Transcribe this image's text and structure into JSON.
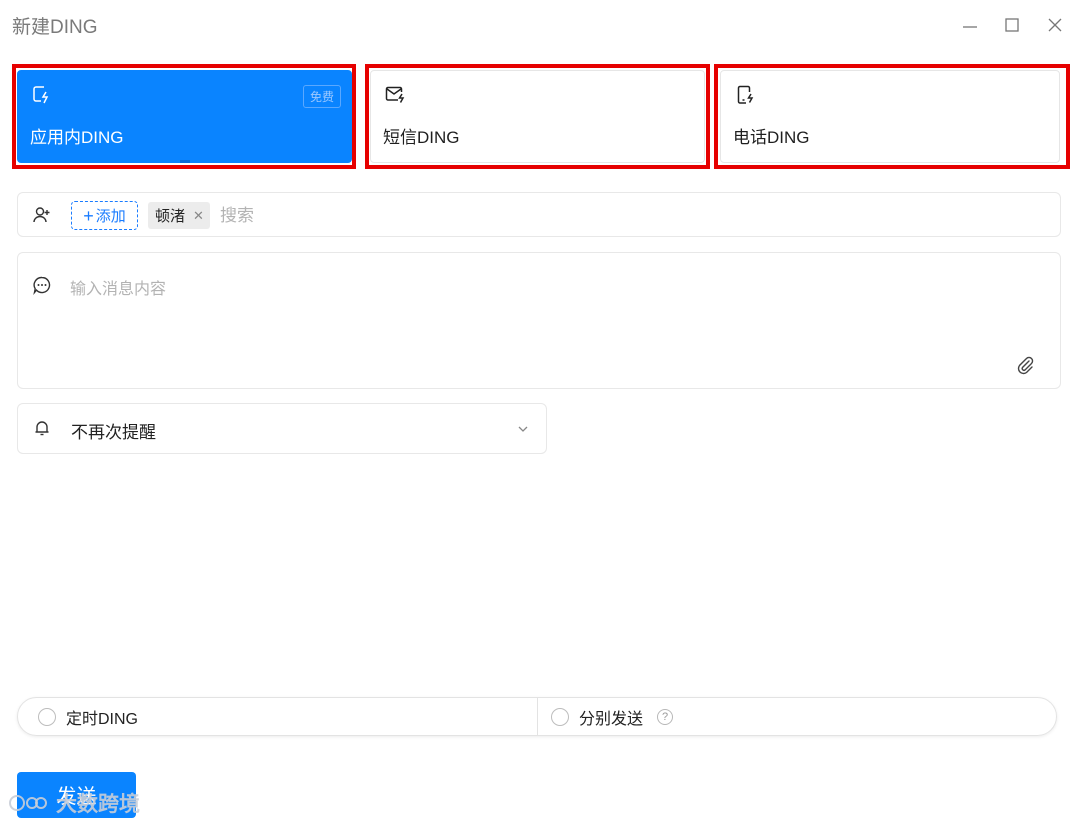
{
  "window": {
    "title": "新建DING"
  },
  "ding_types": [
    {
      "label": "应用内DING",
      "badge": "免费",
      "icon": "app-ding-icon",
      "active": true
    },
    {
      "label": "短信DING",
      "icon": "sms-ding-icon",
      "active": false
    },
    {
      "label": "电话DING",
      "icon": "phone-ding-icon",
      "active": false
    }
  ],
  "recipients": {
    "icon": "add-person-icon",
    "add_label": "添加",
    "selected": [
      {
        "name": "顿渚"
      }
    ],
    "search_placeholder": "搜索"
  },
  "message": {
    "icon": "chat-bubble-icon",
    "placeholder": "输入消息内容",
    "attach_icon": "paperclip-icon"
  },
  "reminder": {
    "icon": "bell-icon",
    "value": "不再次提醒"
  },
  "options": {
    "scheduled_label": "定时DING",
    "separate_send_label": "分别发送",
    "help_glyph": "?"
  },
  "send_label": "发送",
  "watermark": {
    "text": "大数跨境"
  },
  "colors": {
    "accent": "#0a84ff",
    "highlight_border": "#e60000"
  }
}
